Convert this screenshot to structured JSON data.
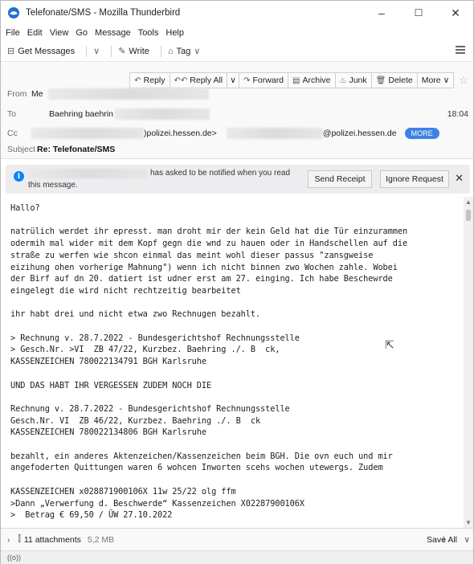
{
  "window": {
    "title": "Telefonate/SMS - Mozilla Thunderbird",
    "minimize": "–",
    "maximize": "☐",
    "close": "✕"
  },
  "menu": [
    "File",
    "Edit",
    "View",
    "Go",
    "Message",
    "Tools",
    "Help"
  ],
  "toolbar": {
    "get_messages": "Get Messages",
    "write": "Write",
    "tag": "Tag"
  },
  "header_actions": [
    "Reply",
    "Reply All",
    "Forward",
    "Archive",
    "Junk",
    "Delete",
    "More"
  ],
  "headers": {
    "from_label": "From",
    "from_value": "Me",
    "to_label": "To",
    "to_value": "Baehring    baehrin",
    "cc_label": "Cc",
    "cc_value1": ")polizei.hessen.de>",
    "cc_value2": "@polizei.hessen.de",
    "more_label": "MORE",
    "subject_label": "Subject",
    "subject_value": "Re: Telefonate/SMS",
    "time": "18:04"
  },
  "notification": {
    "text1": "has asked to be notified when you read",
    "text2": "this message.",
    "send_receipt": "Send Receipt",
    "ignore_request": "Ignore Request",
    "close": "✕"
  },
  "body_lines": [
    "Hallo?",
    "",
    "natrülich werdet ihr epresst. man droht mir der kein Geld hat die Tür einzurammen",
    "odermih mal wider mit dem Kopf gegn die wnd zu hauen oder in Handschellen auf die",
    "straße zu werfen wie shcon einmal das meint wohl dieser passus \"zansgweise",
    "eizihung ohen vorherige Mahnung\") wenn ich nicht binnen zwo Wochen zahle. Wobei",
    "der Birf auf dn 20. datiert ist udner erst am 27. einging. Ich habe Beschewrde",
    "eingelegt die wird nicht rechtzeitig bearbeitet",
    "",
    "ihr habt drei und nicht etwa zwo Rechnugen bezahlt.",
    "",
    "> Rechnung v. 28.7.2022 - Bundesgerichtshof Rechnungsstelle",
    "> Gesch.Nr. >VI  ZB 47/22, Kurzbez. Baehring ./. B  ck,",
    "KASSENZEICHEN 780022134791 BGH Karlsruhe",
    "",
    "UND DAS HABT IHR VERGESSEN ZUDEM NOCH DIE",
    "",
    "Rechnung v. 28.7.2022 - Bundesgerichtshof Rechnungsstelle",
    "Gesch.Nr. VI  ZB 46/22, Kurzbez. Baehring ./. B  ck",
    "KASSENZEICHEN 780022134806 BGH Karlsruhe",
    "",
    "bezahlt, ein anderes Aktenzeichen/Kassenzeichen beim BGH. Die ovn euch und mir",
    "angefoderten Quittungen waren 6 wohcen Inworten scehs wochen utewergs. Zudem",
    "",
    "KASSENZEICHEN x028871900106X 11w 25/22 olg ffm",
    ">Dann „Verwerfung d. Beschwerde“ Kassenzeichen X02287900106X",
    ">  Betrag € 69,50 / ÜW 27.10.2022"
  ],
  "attachments": {
    "label": "11 attachments",
    "size": "5,2 MB",
    "save_all": "Save All"
  },
  "status": "((o))"
}
